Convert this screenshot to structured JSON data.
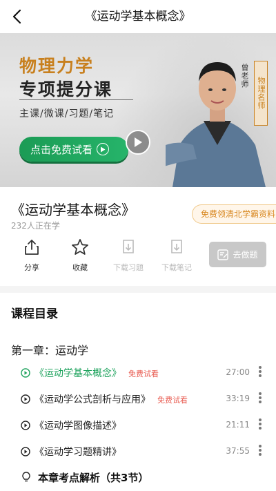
{
  "nav": {
    "title": "《运动学基本概念》"
  },
  "banner": {
    "title_line1": "物理力学",
    "title_line2": "专项提分课",
    "subtitle": "主课/微课/习题/笔记",
    "trial_button": "点击免费试看",
    "teacher_name": "曾老师",
    "teacher_tag": "物理名师"
  },
  "course": {
    "title": "《运动学基本概念》",
    "learners": "232人正在学",
    "free_data_button": "免费领清北学霸资料"
  },
  "actions": {
    "share": "分享",
    "favorite": "收藏",
    "download_exercise": "下载习题",
    "download_notes": "下载笔记",
    "go_practice": "去做题"
  },
  "catalog": {
    "title": "课程目录",
    "chapter": "第一章：运动学",
    "lessons": [
      {
        "name": "《运动学基本概念》",
        "tag": "免费试看",
        "duration": "27:00"
      },
      {
        "name": "《运动学公式剖析与应用》",
        "tag": "免费试看",
        "duration": "33:19"
      },
      {
        "name": "《运动学图像描述》",
        "tag": "",
        "duration": "21:11"
      },
      {
        "name": "《运动学习题精讲》",
        "tag": "",
        "duration": "37:55"
      }
    ],
    "keypoint": "本章考点解析（共3节）"
  },
  "colors": {
    "accent_green": "#1fa35e",
    "accent_orange": "#c8801e",
    "tag_red": "#e85a4f"
  }
}
